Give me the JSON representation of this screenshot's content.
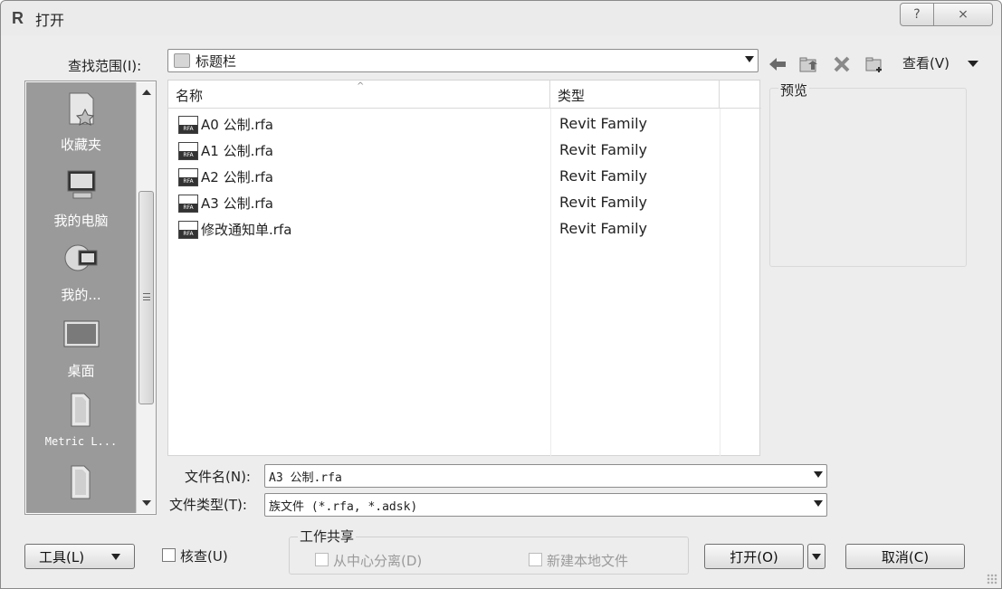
{
  "window": {
    "title": "打开",
    "help_glyph": "?",
    "close_glyph": "⨯"
  },
  "lookin": {
    "label": "查找范围(I):",
    "value": "标题栏"
  },
  "toolbar": {
    "view_label": "查看(V)",
    "icons": [
      "back-icon",
      "up-folder-icon",
      "delete-icon",
      "new-folder-icon",
      "views-icon"
    ]
  },
  "places": [
    {
      "label": "收藏夹",
      "icon": "favorites-icon"
    },
    {
      "label": "我的电脑",
      "icon": "my-computer-icon"
    },
    {
      "label": "我的...",
      "icon": "my-network-icon"
    },
    {
      "label": "桌面",
      "icon": "desktop-icon"
    },
    {
      "label": "Metric L...",
      "icon": "folder-icon"
    },
    {
      "label": "",
      "icon": "folder-icon"
    }
  ],
  "filelist": {
    "columns": {
      "name": "名称",
      "type": "类型"
    },
    "rows": [
      {
        "name": "A0 公制.rfa",
        "type": "Revit Family"
      },
      {
        "name": "A1 公制.rfa",
        "type": "Revit Family"
      },
      {
        "name": "A2 公制.rfa",
        "type": "Revit Family"
      },
      {
        "name": "A3 公制.rfa",
        "type": "Revit Family"
      },
      {
        "name": "修改通知单.rfa",
        "type": "Revit Family"
      }
    ]
  },
  "preview": {
    "label": "预览"
  },
  "filename": {
    "label": "文件名(N):",
    "value": "A3 公制.rfa"
  },
  "filetype": {
    "label": "文件类型(T):",
    "value": "族文件 (*.rfa, *.adsk)"
  },
  "bottom": {
    "tools_label": "工具(L)",
    "audit_label": "核查(U)",
    "worksharing_label": "工作共享",
    "detach_label": "从中心分离(D)",
    "create_local_label": "新建本地文件",
    "open_label": "打开(O)",
    "cancel_label": "取消(C)"
  },
  "colors": {
    "places_bg": "#9a9a9a",
    "dialog_bg": "#ededed"
  }
}
